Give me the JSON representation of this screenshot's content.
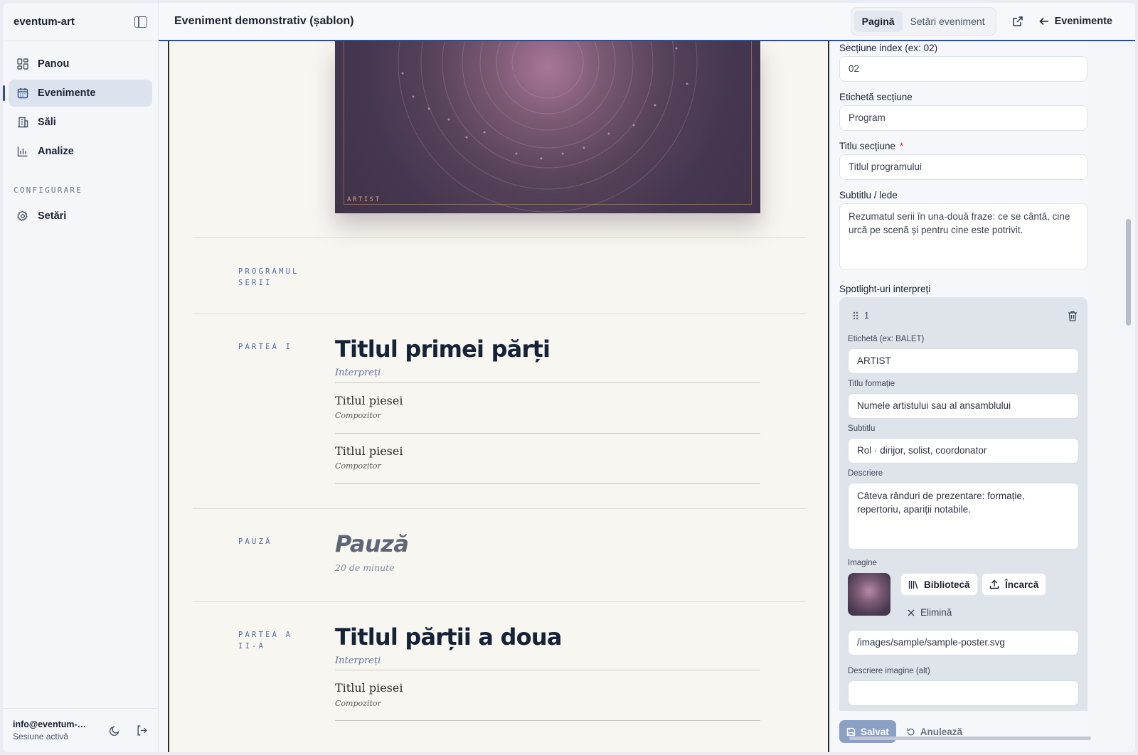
{
  "sidebar": {
    "brand": "eventum-art",
    "items": [
      {
        "label": "Panou",
        "icon": "dashboard-icon"
      },
      {
        "label": "Evenimente",
        "icon": "calendar-icon"
      },
      {
        "label": "Săli",
        "icon": "building-icon"
      },
      {
        "label": "Analize",
        "icon": "bar-chart-icon"
      }
    ],
    "section_label": "CONFIGURARE",
    "settings_label": "Setări",
    "user_email": "info@eventum-art.ro",
    "user_status": "Sesiune activă"
  },
  "header": {
    "title": "Eveniment demonstrativ (șablon)",
    "tabs": [
      "Pagină",
      "Setări eveniment"
    ],
    "active_tab": "Pagină",
    "back_label": "Evenimente"
  },
  "preview": {
    "poster_label": "ARTIST",
    "program_label_1": "PROGRAMUL",
    "program_label_2": "SERII",
    "parts": [
      {
        "label_1": "PARTEA I",
        "label_2": "",
        "title": "Titlul primei părți",
        "performers": "Interpreți",
        "pieces": [
          {
            "title": "Titlul piesei",
            "composer": "Compozitor"
          },
          {
            "title": "Titlul piesei",
            "composer": "Compozitor"
          }
        ]
      },
      {
        "label_1": "PARTEA A",
        "label_2": "II-A",
        "title": "Titlul părții a doua",
        "performers": "Interpreți",
        "pieces": [
          {
            "title": "Titlul piesei",
            "composer": "Compozitor"
          }
        ]
      }
    ],
    "pause": {
      "label": "PAUZĂ",
      "title": "Pauză",
      "duration": "20 de minute"
    }
  },
  "form": {
    "section_index_label": "Secțiune index (ex: 02)",
    "section_index_value": "02",
    "section_tag_label": "Etichetă secțiune",
    "section_tag_value": "Program",
    "section_title_label": "Titlu secțiune",
    "required_mark": "*",
    "section_title_value": "Titlul programului",
    "subtitle_label": "Subtitlu / lede",
    "subtitle_value": "Rezumatul serii în una-două fraze: ce se cântă, cine urcă pe scenă și pentru cine este potrivit.",
    "spotlights_label": "Spotlight-uri interpreți",
    "spotlight": {
      "index": "1",
      "tag_label": "Etichetă (ex: BALET)",
      "tag_value": "ARTIST",
      "title_label": "Titlu formație",
      "title_value": "Numele artistului sau al ansamblului",
      "subtitle_label": "Subtitlu",
      "subtitle_value": "Rol · dirijor, solist, coordonator",
      "desc_label": "Descriere",
      "desc_value": "Câteva rânduri de prezentare: formație, repertoriu, apariții notabile.",
      "image_label": "Imagine",
      "library_label": "Bibliotecă",
      "upload_label": "Încarcă",
      "remove_label": "Elimină",
      "image_path": "/images/sample/sample-poster.svg",
      "alt_label": "Descriere imagine (alt)",
      "alt_value": ""
    },
    "save_label": "Salvat",
    "cancel_label": "Anulează"
  },
  "colors": {
    "accent": "#2f4d8f",
    "preview_bg": "#f8f6f0",
    "poster": "#463750",
    "label_blue": "#4d6aa0"
  }
}
